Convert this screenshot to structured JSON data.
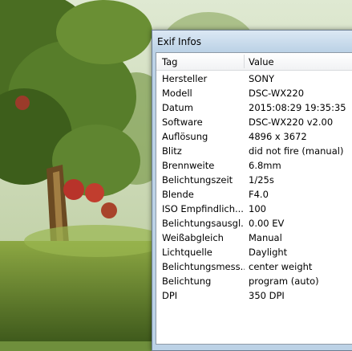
{
  "window": {
    "title": "Exif Infos"
  },
  "table": {
    "columns": [
      "Tag",
      "Value"
    ],
    "rows": [
      [
        "Hersteller",
        "SONY"
      ],
      [
        "Modell",
        "DSC-WX220"
      ],
      [
        "Datum",
        "2015:08:29 19:35:35"
      ],
      [
        "Software",
        "DSC-WX220 v2.00"
      ],
      [
        "Auflösung",
        "4896 x 3672"
      ],
      [
        "Blitz",
        "did not fire (manual)"
      ],
      [
        "Brennweite",
        "6.8mm"
      ],
      [
        "Belichtungszeit",
        "1/25s"
      ],
      [
        "Blende",
        "F4.0"
      ],
      [
        "ISO Empfindlich...",
        "100"
      ],
      [
        "Belichtungsausgl...",
        "0.00 EV"
      ],
      [
        "Weißabgleich",
        "Manual"
      ],
      [
        "Lichtquelle",
        "Daylight"
      ],
      [
        "Belichtungsmess...",
        "center weight"
      ],
      [
        "Belichtung",
        "program (auto)"
      ],
      [
        "DPI",
        "350 DPI"
      ]
    ]
  }
}
